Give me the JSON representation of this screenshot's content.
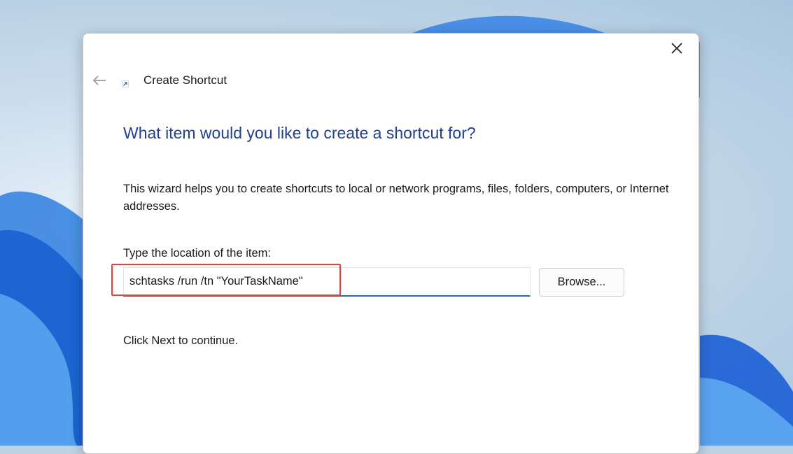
{
  "window": {
    "title": "Create Shortcut",
    "close_icon": "close-icon",
    "back_icon": "back-arrow-icon",
    "title_icon": "shortcut-arrow-icon"
  },
  "content": {
    "heading": "What item would you like to create a shortcut for?",
    "description": "This wizard helps you to create shortcuts to local or network programs, files, folders, computers, or Internet addresses.",
    "location_label": "Type the location of the item:",
    "location_value": "schtasks /run /tn \"YourTaskName\"",
    "browse_label": "Browse...",
    "continue_text": "Click Next to continue."
  },
  "colors": {
    "heading": "#1f3f9a",
    "input_underline": "#2a63ad",
    "highlight": "#e0453c"
  }
}
